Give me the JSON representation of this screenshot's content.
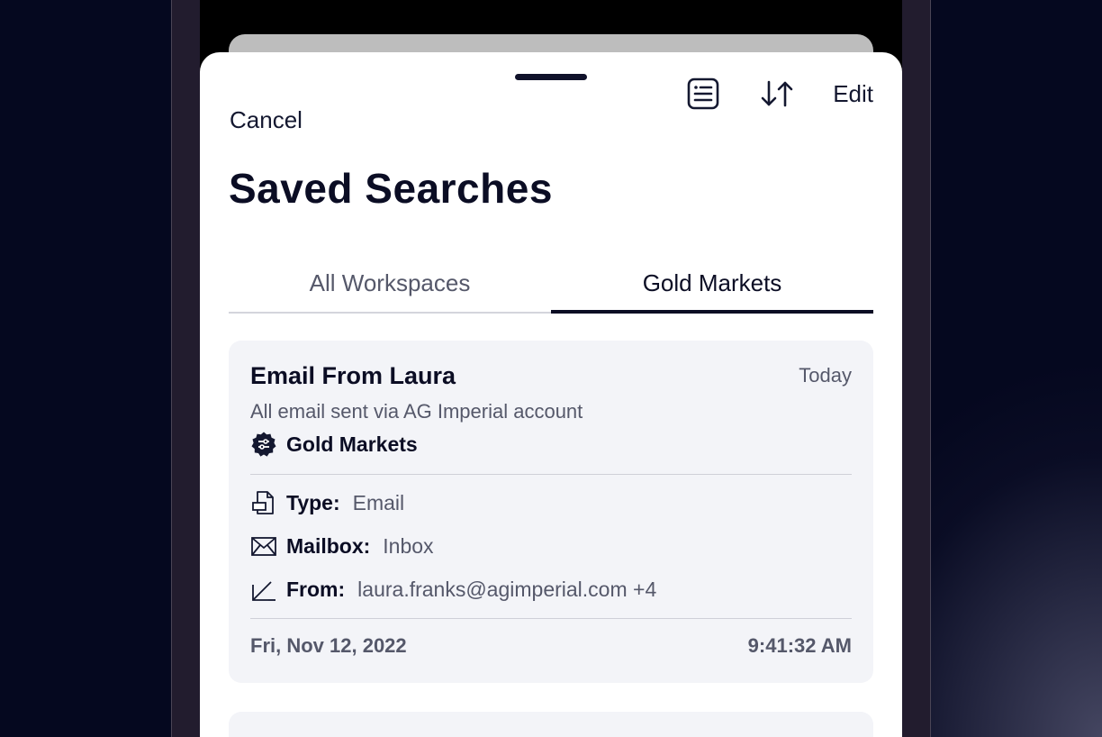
{
  "header": {
    "cancel_label": "Cancel",
    "edit_label": "Edit",
    "title": "Saved Searches"
  },
  "tabs": [
    {
      "label": "All Workspaces",
      "active": false
    },
    {
      "label": "Gold Markets",
      "active": true
    }
  ],
  "saved_search": {
    "title": "Email From Laura",
    "date_label": "Today",
    "description": "All email sent via AG Imperial account",
    "workspace": "Gold Markets",
    "details": [
      {
        "key": "Type:",
        "value": "Email",
        "icon": "document-icon"
      },
      {
        "key": "Mailbox:",
        "value": "Inbox",
        "icon": "envelope-icon"
      },
      {
        "key": "From:",
        "value": "laura.franks@agimperial.com +4",
        "icon": "arrow-down-left-icon"
      }
    ],
    "footer_date": "Fri, Nov 12, 2022",
    "footer_time": "9:41:32 AM"
  },
  "colors": {
    "background": "#05081f",
    "sheet": "#ffffff",
    "card": "#f3f4f8",
    "text_primary": "#0b0d24",
    "text_secondary": "#55586a"
  }
}
